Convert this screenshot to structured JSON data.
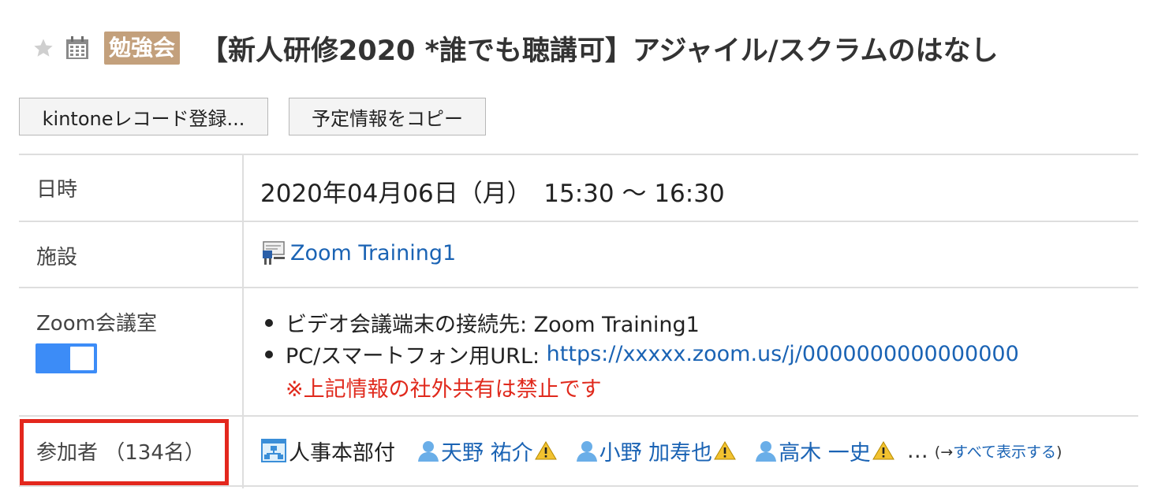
{
  "header": {
    "category_badge": "勉強会",
    "title": "【新人研修2020 *誰でも聴講可】アジャイル/スクラムのはなし"
  },
  "toolbar": {
    "kintone_button": "kintoneレコード登録...",
    "copy_button": "予定情報をコピー"
  },
  "rows": {
    "datetime": {
      "label": "日時",
      "value": "2020年04月06日（月）　15:30 〜 16:30"
    },
    "facility": {
      "label": "施設",
      "value": "Zoom Training1"
    },
    "zoom": {
      "label": "Zoom会議室",
      "toggle_on": true,
      "bullet1": "ビデオ会議端末の接続先: Zoom Training1",
      "bullet2_prefix": "PC/スマートフォン用URL: ",
      "bullet2_url": "https://xxxxx.zoom.us/j/0000000000000000",
      "warning": "※上記情報の社外共有は禁止です"
    },
    "participants": {
      "label": "参加者 （134名）",
      "org": "人事本部付",
      "people": [
        "天野 祐介",
        "小野 加寿也",
        "高木 一史"
      ],
      "ellipsis": "…",
      "show_all_prefix": "(→",
      "show_all": "すべて表示する",
      "show_all_suffix": ")"
    }
  },
  "colors": {
    "accent_link": "#1a63b4",
    "badge": "#c3a07c",
    "warning": "#e0291c",
    "toggle": "#3c8cf7",
    "highlight_box": "#e3271d"
  }
}
